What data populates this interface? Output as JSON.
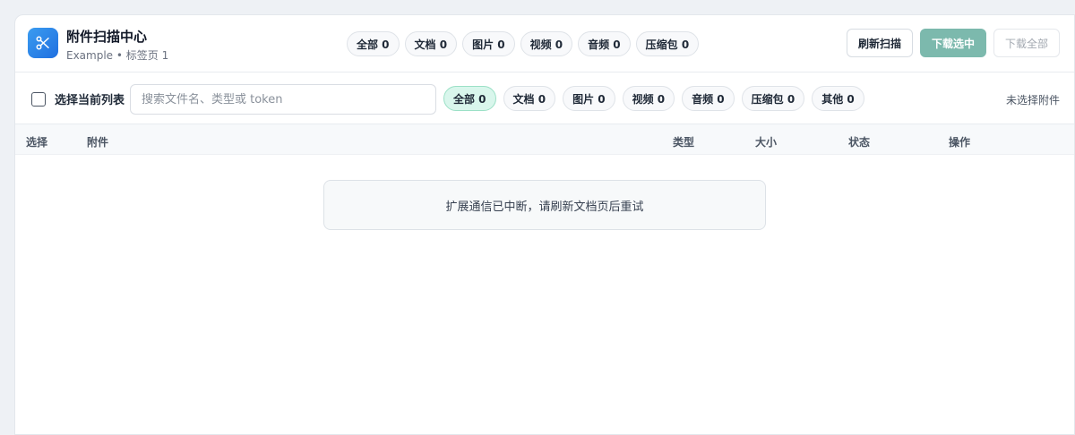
{
  "header": {
    "title": "附件扫描中心",
    "subtitle": "Example • 标签页 1",
    "logo_icon": "scissors-icon",
    "chips": [
      {
        "label": "全部 0"
      },
      {
        "label": "文档 0"
      },
      {
        "label": "图片 0"
      },
      {
        "label": "视频 0"
      },
      {
        "label": "音频 0"
      },
      {
        "label": "压缩包 0"
      }
    ],
    "actions": {
      "refresh": "刷新扫描",
      "download_selected": "下载选中",
      "download_all": "下载全部"
    }
  },
  "toolbar": {
    "select_all_label": "选择当前列表",
    "search_placeholder": "搜索文件名、类型或 token",
    "search_value": "",
    "filters": [
      {
        "label": "全部 0",
        "active": true
      },
      {
        "label": "文档 0"
      },
      {
        "label": "图片 0"
      },
      {
        "label": "视频 0"
      },
      {
        "label": "音频 0"
      },
      {
        "label": "压缩包 0"
      },
      {
        "label": "其他 0"
      }
    ],
    "selection_status": "未选择附件"
  },
  "table": {
    "columns": {
      "select": "选择",
      "attachment": "附件",
      "type": "类型",
      "size": "大小",
      "status": "状态",
      "actions": "操作"
    },
    "rows": []
  },
  "empty_message": "扩展通信已中断，请刷新文档页后重试",
  "colors": {
    "accent": "#1f6fe0",
    "primary_button": "#7cb9ad",
    "active_chip": "#d9f6ec"
  }
}
